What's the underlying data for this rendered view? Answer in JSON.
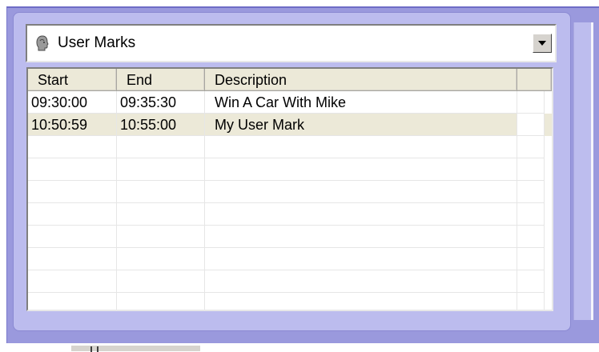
{
  "combo": {
    "selected": "User Marks",
    "icon": "user-head-icon"
  },
  "table": {
    "columns": [
      "Start",
      "End",
      "Description"
    ],
    "rows": [
      {
        "start": "09:30:00",
        "end": "09:35:30",
        "description": "Win A Car With Mike",
        "selected": false
      },
      {
        "start": "10:50:59",
        "end": "10:55:00",
        "description": "My User Mark",
        "selected": true
      }
    ]
  },
  "colors": {
    "frame": "#9a99dd",
    "panel": "#bcbcee",
    "selected_row": "#ece9d8",
    "header": "#ece9d8"
  }
}
